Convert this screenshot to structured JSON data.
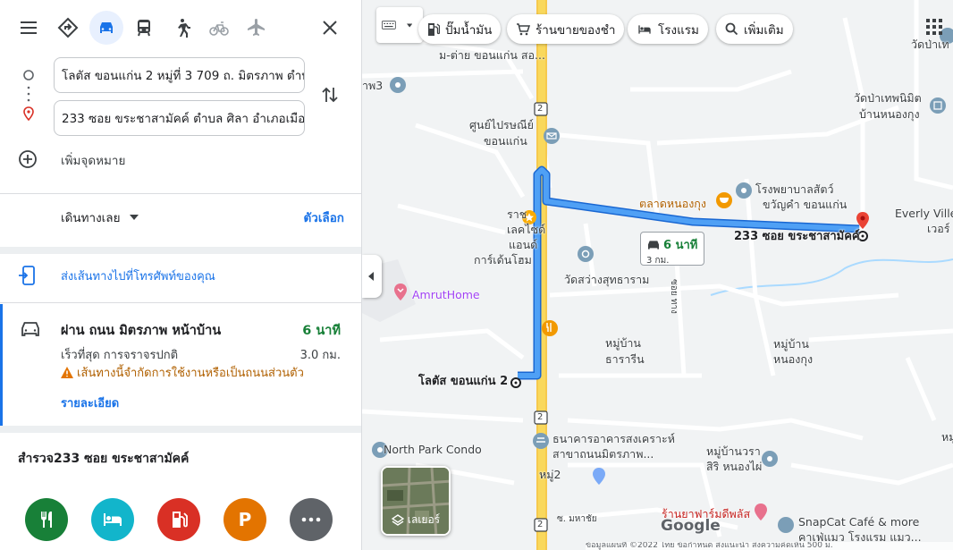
{
  "panel": {
    "modes": [
      {
        "name": "menu-icon"
      },
      {
        "name": "best-route-icon"
      },
      {
        "name": "car-icon",
        "active": true
      },
      {
        "name": "transit-icon"
      },
      {
        "name": "walk-icon"
      },
      {
        "name": "bicycle-icon",
        "disabled": true
      },
      {
        "name": "flight-icon",
        "disabled": true
      },
      {
        "name": "close-icon"
      }
    ],
    "origin_value": "โลตัส ขอนแก่น 2 หมู่ที่ 3 709 ถ. มิตรภาพ ตำบ",
    "destination_value": "233 ซอย ขระชาสามัคค์ ตำบล ศิลา อำเภอเมือง",
    "add_destination": "เพิ่มจุดหมาย",
    "depart_label": "เดินทางเลย",
    "options_label": "ตัวเลือก",
    "send_to_phone": "ส่งเส้นทางไปที่โทรศัพท์ของคุณ",
    "route": {
      "via": "ผ่าน ถนน มิตรภาพ หน้าบ้าน",
      "time": "6 นาที",
      "traffic": "เร็วที่สุด การจราจรปกติ",
      "distance": "3.0 กม.",
      "warning": "เส้นทางนี้จำกัดการใช้งานหรือเป็นถนนส่วนตัว",
      "details": "รายละเอียด"
    },
    "explore_title": "สำรวจ233 ซอย ขระชาสามัคค์",
    "categories": [
      {
        "name": "restaurants",
        "color": "#188038"
      },
      {
        "name": "hotels",
        "color": "#12b5cb"
      },
      {
        "name": "gas-stations",
        "color": "#d93025"
      },
      {
        "name": "parking",
        "color": "#e37400",
        "glyph": "P"
      },
      {
        "name": "more",
        "color": "#5f6368"
      }
    ]
  },
  "map": {
    "chips": {
      "gas": "ปั๊มน้ำมัน",
      "grocery": "ร้านขายของชำ",
      "hotels": "โรงแรม",
      "more": "เพิ่มเติม"
    },
    "labels": {
      "top_partial": "ม-ต่าย ขอนแก่น สอ...",
      "temple_pa3": "าพ3",
      "post_office_1": "ศูนย์ไปรษณีย์",
      "post_office_2": "ขอนแก่น",
      "temple_top_right": "วัดป่าเท",
      "temple_tep_1": "วัดป่าเทพนิมิต",
      "temple_tep_2": "บ้านหนองกุง",
      "vet_1": "โรงพยาบาลสัตว์",
      "vet_2": "ขวัญคำ ขอนแก่น",
      "market": "ตลาดหนองกุง",
      "everly_1": "Everly Ville",
      "everly_2": "เวอร์",
      "garden_1": "ราช",
      "garden_2": "เลคไซด์",
      "garden_3": "แอนด์",
      "garden_4": "การ์เด้นโฮม",
      "destination": "233 ซอย ขระชาสามัคค์",
      "temple_sawang": "วัดสว่างสุทธาราม",
      "amrut": "AmrutHome",
      "soi_label": "ซอย ทาง",
      "village_thara_1": "หมู่บ้าน",
      "village_thara_2": "ธารารีน",
      "village_nongkung_1": "หมู่บ้าน",
      "village_nongkung_2": "หนองกุง",
      "origin": "โลตัส ขอนแก่น 2",
      "north_park": "North Park Condo",
      "bank_1": "ธนาคารอาคารสงเคราะห์",
      "bank_2": "สาขาถนนมิตรภาพ...",
      "village_wara_1": "หมู่บ้านวรา",
      "village_wara_2": "สิริ หนองไผ่",
      "moo2": "หมู่2",
      "soi_mahachai": "ซ. มหาชัย",
      "pharmacy_1": "ร้านยาฟาร์มดีพลัส",
      "pharmacy_2": "Google",
      "snapcat_1": "SnapCat Café & more",
      "snapcat_2": "คาเฟ่แมว โรงแรม แมว...",
      "right_edge": "หมู่"
    },
    "route_shields": [
      "2",
      "2",
      "2"
    ],
    "eta": {
      "time": "6 นาที",
      "distance": "3 กม."
    },
    "layers_label": "เลเยอร์",
    "footer": "ข้อมูลแผนที่ ©2022   ไทย   ข้อกำหนด   ส่งแนะนำ   ส่งความคิดเห็น   500 ม."
  }
}
